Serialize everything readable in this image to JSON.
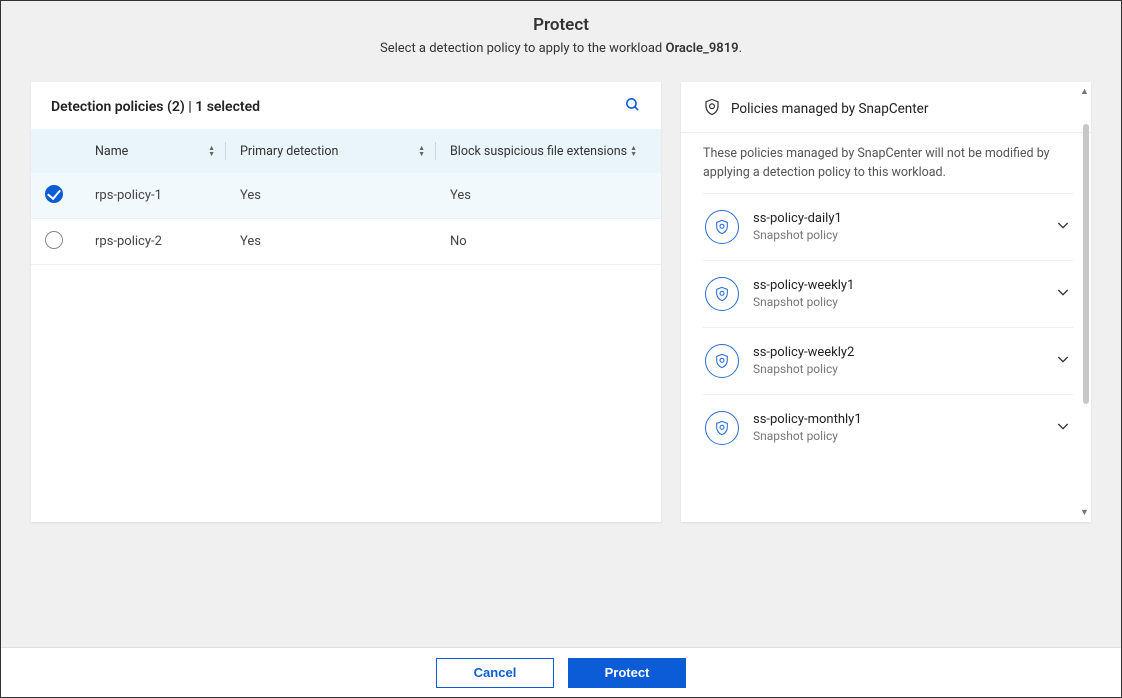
{
  "header": {
    "title": "Protect",
    "subtitle_prefix": "Select a detection policy to apply to the workload ",
    "workload": "Oracle_9819",
    "subtitle_suffix": "."
  },
  "detection": {
    "panel_title": "Detection policies (2) | 1 selected",
    "columns": {
      "name": "Name",
      "primary": "Primary detection",
      "block": "Block suspicious file extensions"
    },
    "rows": [
      {
        "name": "rps-policy-1",
        "primary": "Yes",
        "block": "Yes",
        "selected": true
      },
      {
        "name": "rps-policy-2",
        "primary": "Yes",
        "block": "No",
        "selected": false
      }
    ]
  },
  "managed": {
    "title": "Policies managed by SnapCenter",
    "info": "These policies managed by SnapCenter will not be modified by applying a detection policy to this workload.",
    "items": [
      {
        "name": "ss-policy-daily1",
        "sub": "Snapshot policy"
      },
      {
        "name": "ss-policy-weekly1",
        "sub": "Snapshot policy"
      },
      {
        "name": "ss-policy-weekly2",
        "sub": "Snapshot policy"
      },
      {
        "name": "ss-policy-monthly1",
        "sub": "Snapshot policy"
      }
    ]
  },
  "footer": {
    "cancel": "Cancel",
    "protect": "Protect"
  }
}
